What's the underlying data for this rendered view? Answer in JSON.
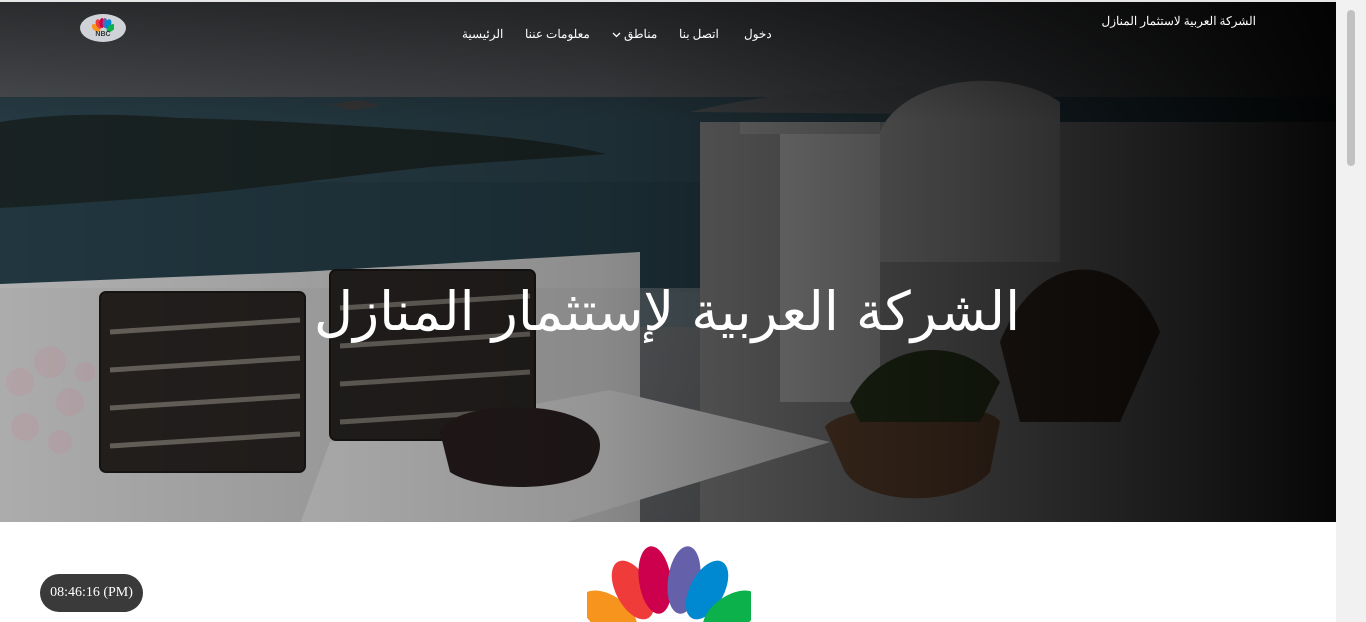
{
  "header": {
    "brand_text": "الشركة العربية لاستثمار المنازل",
    "logo_text": "NBC",
    "nav": {
      "home": "الرئيسية",
      "about": "معلومات عننا",
      "regions": "مناطق",
      "contact": "اتصل بنا",
      "login": "دخول"
    }
  },
  "hero": {
    "title": "الشركة العربية لإستثمار المنازل"
  },
  "clock": {
    "time": "08:46:16 (PM)"
  },
  "colors": {
    "peacock": [
      "#f7941d",
      "#ef3b39",
      "#cc004c",
      "#6460aa",
      "#0089d0",
      "#0db14b"
    ],
    "clock_bg": "#3a3a3a"
  }
}
